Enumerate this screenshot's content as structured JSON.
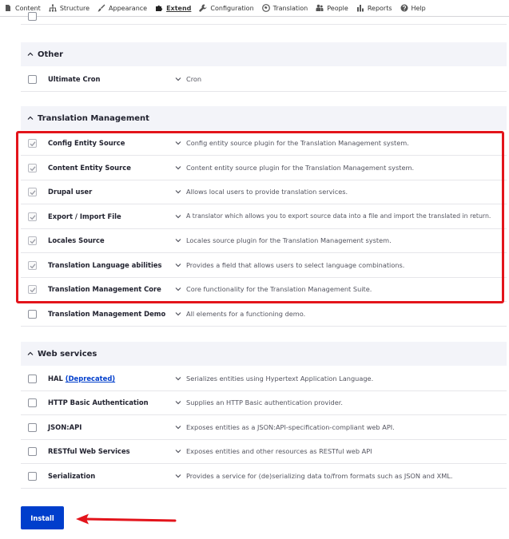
{
  "toolbar": {
    "items": [
      {
        "label": "Content",
        "icon": "page-icon"
      },
      {
        "label": "Structure",
        "icon": "sitemap-icon"
      },
      {
        "label": "Appearance",
        "icon": "brush-icon"
      },
      {
        "label": "Extend",
        "icon": "puzzle-icon",
        "active": true
      },
      {
        "label": "Configuration",
        "icon": "wrench-icon"
      },
      {
        "label": "Translation",
        "icon": "globe-icon"
      },
      {
        "label": "People",
        "icon": "people-icon"
      },
      {
        "label": "Reports",
        "icon": "bar-chart-icon"
      },
      {
        "label": "Help",
        "icon": "help-icon"
      }
    ]
  },
  "groups": {
    "other": {
      "title": "Other",
      "modules": [
        {
          "name": "Ultimate Cron",
          "description": "Cron",
          "checked": false
        }
      ]
    },
    "translation_management": {
      "title": "Translation Management",
      "modules": [
        {
          "name": "Config Entity Source",
          "description": "Config entity source plugin for the Translation Management system.",
          "checked": true
        },
        {
          "name": "Content Entity Source",
          "description": "Content entity source plugin for the Translation Management system.",
          "checked": true
        },
        {
          "name": "Drupal user",
          "description": "Allows local users to provide translation services.",
          "checked": true
        },
        {
          "name": "Export / Import File",
          "description": "A translator which allows you to export source data into a file and import the translated in return.",
          "checked": true
        },
        {
          "name": "Locales Source",
          "description": "Locales source plugin for the Translation Management system.",
          "checked": true
        },
        {
          "name": "Translation Language abilities",
          "description": "Provides a field that allows users to select language combinations.",
          "checked": true
        },
        {
          "name": "Translation Management Core",
          "description": "Core functionality for the Translation Management Suite.",
          "checked": true
        },
        {
          "name": "Translation Management Demo",
          "description": "All elements for a functioning demo.",
          "checked": false
        }
      ]
    },
    "web_services": {
      "title": "Web services",
      "modules": [
        {
          "name": "HAL",
          "deprecated_label": "(Deprecated)",
          "description": "Serializes entities using Hypertext Application Language.",
          "checked": false
        },
        {
          "name": "HTTP Basic Authentication",
          "description": "Supplies an HTTP Basic authentication provider.",
          "checked": false
        },
        {
          "name": "JSON:API",
          "description": "Exposes entities as a JSON:API-specification-compliant web API.",
          "checked": false
        },
        {
          "name": "RESTful Web Services",
          "description": "Exposes entities and other resources as RESTful web API",
          "checked": false
        },
        {
          "name": "Serialization",
          "description": "Provides a service for (de)serializing data to/from formats such as JSON and XML.",
          "checked": false
        }
      ]
    }
  },
  "actions": {
    "install_label": "Install"
  },
  "colors": {
    "primary": "#003ecc",
    "highlight": "#e3141b",
    "group_bg": "#f3f4f9"
  }
}
